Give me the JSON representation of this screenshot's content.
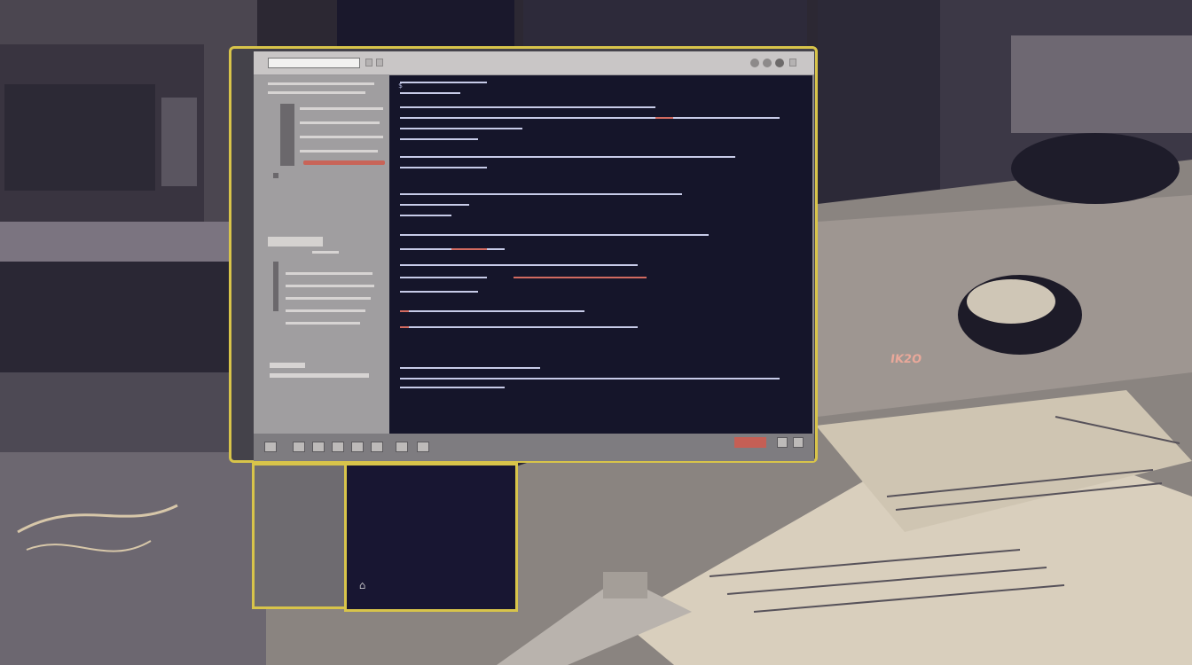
{
  "window": {
    "tab_field": "",
    "url": "",
    "controls": [
      "minimize-icon",
      "maximize-icon",
      "close-icon"
    ]
  },
  "sidebar": {
    "section_label": ""
  },
  "terminal": {
    "lines": [
      "$ ",
      "",
      "",
      "",
      "",
      "",
      "",
      "",
      "",
      "",
      ""
    ]
  },
  "monitor": {
    "brand": "IK2O"
  },
  "colors": {
    "frame": "#d8c44a",
    "terminal_bg": "#15152a",
    "accent_red": "#c55f55"
  }
}
